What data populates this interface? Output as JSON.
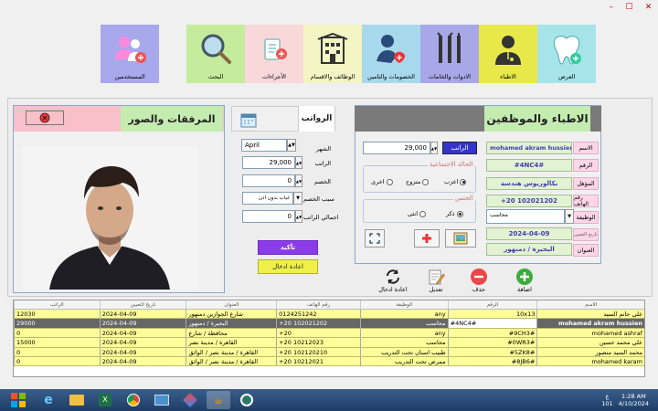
{
  "window": {
    "minimize": "–",
    "maximize": "☐",
    "close": "✕"
  },
  "nav": [
    {
      "key": "clinic",
      "label": "العرض",
      "bg": "#a6e4ea",
      "icon": "tooth-icon"
    },
    {
      "key": "doctors",
      "label": "الاطباء",
      "bg": "#e8e84a",
      "icon": "doctor-icon"
    },
    {
      "key": "tools",
      "label": "الادوات والخامات",
      "bg": "#a8a8e8",
      "icon": "dental-tools-icon"
    },
    {
      "key": "discounts",
      "label": "الخصومات والتامين",
      "bg": "#a8d8ec",
      "icon": "patient-care-icon"
    },
    {
      "key": "jobs",
      "label": "الوظائف والاقسام",
      "bg": "#f4f4c4",
      "icon": "building-icon"
    },
    {
      "key": "wages",
      "label": "الأجراءات",
      "bg": "#f8d8d8",
      "icon": "dentist-chair-icon"
    },
    {
      "key": "search",
      "label": "البحث",
      "bg": "#c4ec9c",
      "icon": "magnifier-icon"
    },
    {
      "key": "users",
      "label": "المستخدمين",
      "bg": "#a8a8ec",
      "icon": "users-icon"
    }
  ],
  "staff": {
    "header": "الاطباء والموظفين",
    "labels": {
      "name": "الاسم",
      "id": "الرقم",
      "qualification": "المؤهل",
      "phone": "رقم الهاتف",
      "job": "الوظيفة",
      "hire_date": "تاريخ التعيين",
      "address": "العنوان"
    },
    "values": {
      "name": "mohamed akram hussien",
      "id": "#4NC4#",
      "qualification": "بكالوريوس هندسة",
      "phone": "+20 102021202",
      "job": "محاسب",
      "hire_date": "2024-04-09",
      "address": "البحيرة / دمنهور"
    },
    "salary_label": "الراتب",
    "salary_value": "29,000",
    "marital_title": "الحالة الاجتماعية",
    "marital_options": [
      "اعزب",
      "متزوج",
      "اخرى"
    ],
    "gender_title": "الجنس",
    "gender_options": [
      "ذكر",
      "انثى"
    ]
  },
  "actions": {
    "add": "اضافة",
    "delete": "حذف",
    "edit": "تعديل",
    "reset": "اعادة ادخال"
  },
  "salaries": {
    "header": "الرواتب",
    "labels": {
      "month": "الشهر",
      "salary": "الراتب",
      "deduction": "الخصم",
      "reason": "سبب الخصم",
      "total": "اجمالي الراتب"
    },
    "values": {
      "month": "April",
      "salary": "29,000",
      "deduction": "0",
      "reason": "غياب بدون اذن",
      "total": "0"
    },
    "confirm": "تأكيد",
    "reset": "اعادة ادخال"
  },
  "attachments": {
    "header": "المرفقات والصور"
  },
  "table": {
    "headers": [
      "الراتب",
      "تاريخ التعيين",
      "العنوان",
      "رقم الهاتف",
      "الوظيفة",
      "الرقم",
      "الاسم"
    ],
    "rows": [
      [
        "12030",
        "2024-04-09",
        "شارع الجوازين دمنهور",
        "0124251242",
        "any",
        "10x13",
        "علي حاتم السيد"
      ],
      [
        "29000",
        "2024-04-09",
        "البحيرة / دمنهور",
        "+20 102021202",
        "محاسب",
        "#4NC4#",
        "mohamed akram hussien"
      ],
      [
        "0",
        "2024-04-09",
        "محافظة / شارع",
        "+20",
        "any",
        "#9CH3#",
        "mohamed ashraf"
      ],
      [
        "15000",
        "2024-04-09",
        "القاهرة / مدينة نصر",
        "+20 10212023",
        "محاسب",
        "#0WR3#",
        "علي محمد حسين"
      ],
      [
        "0",
        "2024-04-09",
        "القاهرة / مدينة نصر / الواثق",
        "+20 102120210",
        "طبيب اسنان تحت التدريب",
        "#5ZK8#",
        "محمد السيد منصور"
      ],
      [
        "0",
        "2024-04-09",
        "القاهرة / مدينة نصر / الواثق",
        "+20 10212021",
        "ممرض تحت التدريب",
        "#8JB6#",
        "mohamed karam"
      ]
    ]
  },
  "taskbar": {
    "time": "1:28 AM",
    "date": "4/10/2024",
    "lang": "ع",
    "num": "101"
  }
}
